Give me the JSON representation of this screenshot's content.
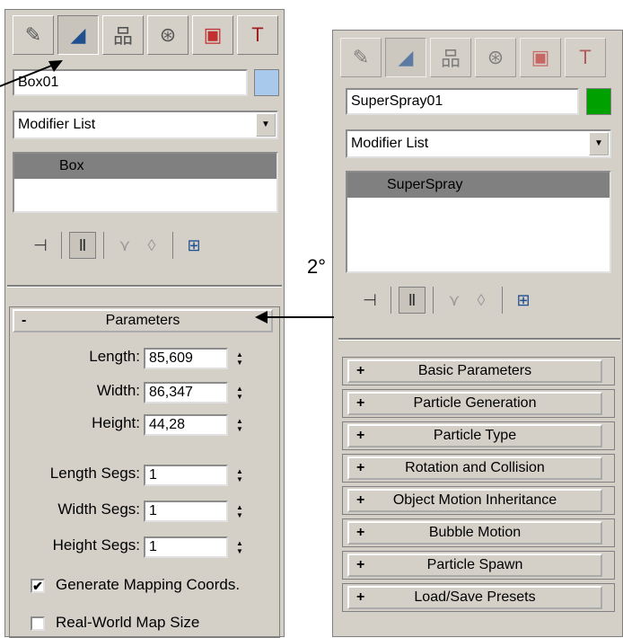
{
  "left_panel": {
    "tabs": [
      "create-icon",
      "modify-icon",
      "hierarchy-icon",
      "motion-icon",
      "display-icon",
      "utilities-icon"
    ],
    "object_name": "Box01",
    "color_swatch": "#a8c8ec",
    "modifier_list": "Modifier List",
    "stack_item": "Box",
    "parameters_rollout": {
      "sign": "-",
      "title": "Parameters"
    },
    "params": [
      {
        "label": "Length:",
        "value": "85,609"
      },
      {
        "label": "Width:",
        "value": "86,347"
      },
      {
        "label": "Height:",
        "value": "44,28"
      }
    ],
    "segs": [
      {
        "label": "Length Segs:",
        "value": "1"
      },
      {
        "label": "Width Segs:",
        "value": "1"
      },
      {
        "label": "Height Segs:",
        "value": "1"
      }
    ],
    "generate_mapping": {
      "label": "Generate Mapping Coords.",
      "checked": true,
      "mark": "✔"
    },
    "real_world": {
      "label": "Real-World Map Size",
      "checked": false
    }
  },
  "annotation_number": "2°",
  "right_panel": {
    "object_name": "SuperSpray01",
    "color_swatch": "#00a000",
    "modifier_list": "Modifier List",
    "stack_item": "SuperSpray",
    "rollouts": [
      {
        "sign": "+",
        "title": "Basic Parameters"
      },
      {
        "sign": "+",
        "title": "Particle Generation"
      },
      {
        "sign": "+",
        "title": "Particle Type"
      },
      {
        "sign": "+",
        "title": "Rotation and Collision"
      },
      {
        "sign": "+",
        "title": "Object Motion Inheritance"
      },
      {
        "sign": "+",
        "title": "Bubble Motion"
      },
      {
        "sign": "+",
        "title": "Particle Spawn"
      },
      {
        "sign": "+",
        "title": "Load/Save Presets"
      }
    ]
  }
}
